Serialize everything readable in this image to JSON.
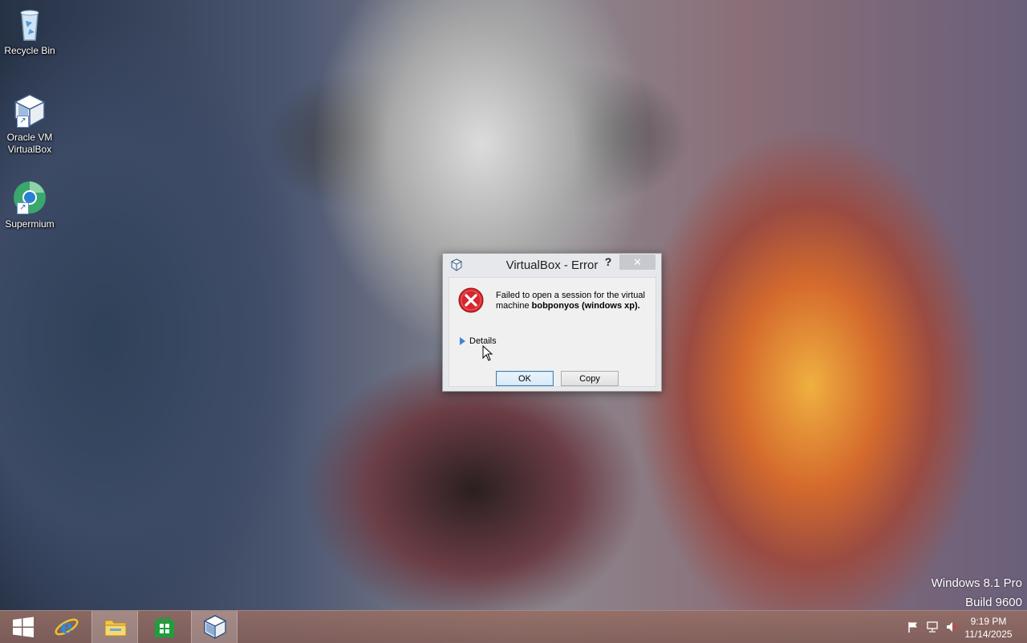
{
  "desktop": {
    "icons": [
      {
        "label": "Recycle Bin",
        "icon": "recycle-bin-icon"
      },
      {
        "label": "Oracle VM\nVirtualBox",
        "icon": "virtualbox-icon"
      },
      {
        "label": "Supermium",
        "icon": "supermium-icon"
      }
    ],
    "watermark": {
      "line1": "Windows 8.1 Pro",
      "line2": "Build 9600"
    }
  },
  "dialog": {
    "title": "VirtualBox - Error",
    "help_label": "?",
    "close_label": "✕",
    "message_plain": "Failed to open a session for the virtual machine ",
    "message_bold": "bobponyos (windows xp)",
    "message_tail": ".",
    "details_label": "Details",
    "ok_label": "OK",
    "copy_label": "Copy"
  },
  "taskbar": {
    "items": [
      {
        "name": "start",
        "icon": "windows-logo-icon"
      },
      {
        "name": "internet-explorer",
        "icon": "internet-explorer-icon"
      },
      {
        "name": "file-explorer",
        "icon": "folder-icon"
      },
      {
        "name": "store",
        "icon": "store-icon"
      },
      {
        "name": "virtualbox",
        "icon": "virtualbox-icon"
      }
    ],
    "tray": {
      "icons": [
        "action-center-flag-icon",
        "network-icon",
        "volume-muted-icon"
      ],
      "time": "9:19 PM",
      "date": "11/14/2025"
    }
  },
  "colors": {
    "dialog_bg": "#f0f0f0",
    "error_red": "#d7262d",
    "accent_blue": "#3a86d6"
  }
}
